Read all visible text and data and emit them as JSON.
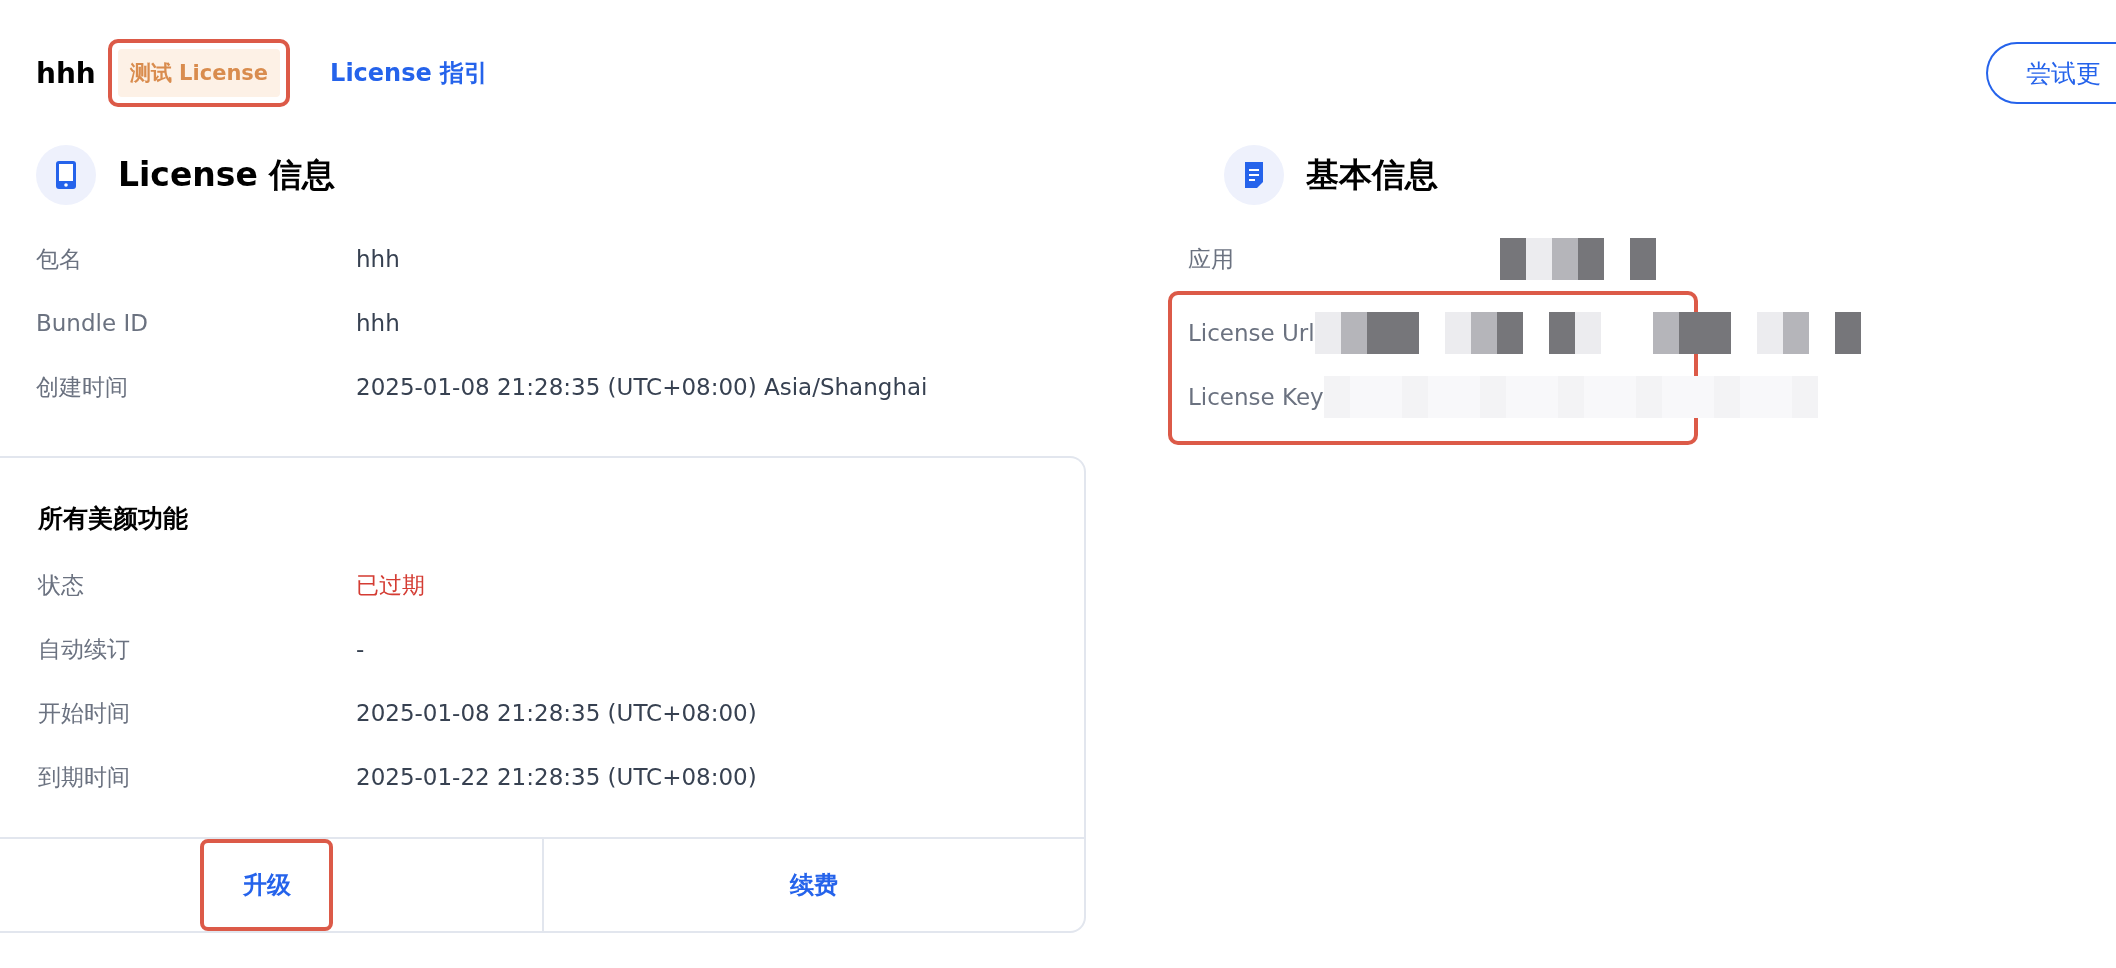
{
  "header": {
    "name": "hhh",
    "badge": {
      "label": "测试 License",
      "highlighted": true
    },
    "guide_link": "License 指引",
    "try_button": "尝试更"
  },
  "license_info": {
    "title": "License 信息",
    "rows": [
      {
        "label": "包名",
        "value": "hhh"
      },
      {
        "label": "Bundle ID",
        "value": "hhh"
      },
      {
        "label": "创建时间",
        "value": "2025-01-08 21:28:35 (UTC+08:00) Asia/Shanghai"
      }
    ]
  },
  "basic_info": {
    "title": "基本信息",
    "rows": [
      {
        "label": "应用"
      }
    ],
    "highlighted_group": {
      "highlighted": true,
      "rows": [
        {
          "label": "License Url"
        },
        {
          "label": "License Key"
        }
      ]
    }
  },
  "feature_card": {
    "title": "所有美颜功能",
    "rows": [
      {
        "label": "状态",
        "value": "已过期",
        "kind": "status"
      },
      {
        "label": "自动续订",
        "value": "-",
        "kind": "text"
      },
      {
        "label": "开始时间",
        "value": "2025-01-08 21:28:35 (UTC+08:00)",
        "kind": "text"
      },
      {
        "label": "到期时间",
        "value": "2025-01-22 21:28:35 (UTC+08:00)",
        "kind": "text"
      }
    ],
    "actions": [
      {
        "label": "升级",
        "highlighted": true
      },
      {
        "label": "续费",
        "highlighted": false
      }
    ]
  }
}
